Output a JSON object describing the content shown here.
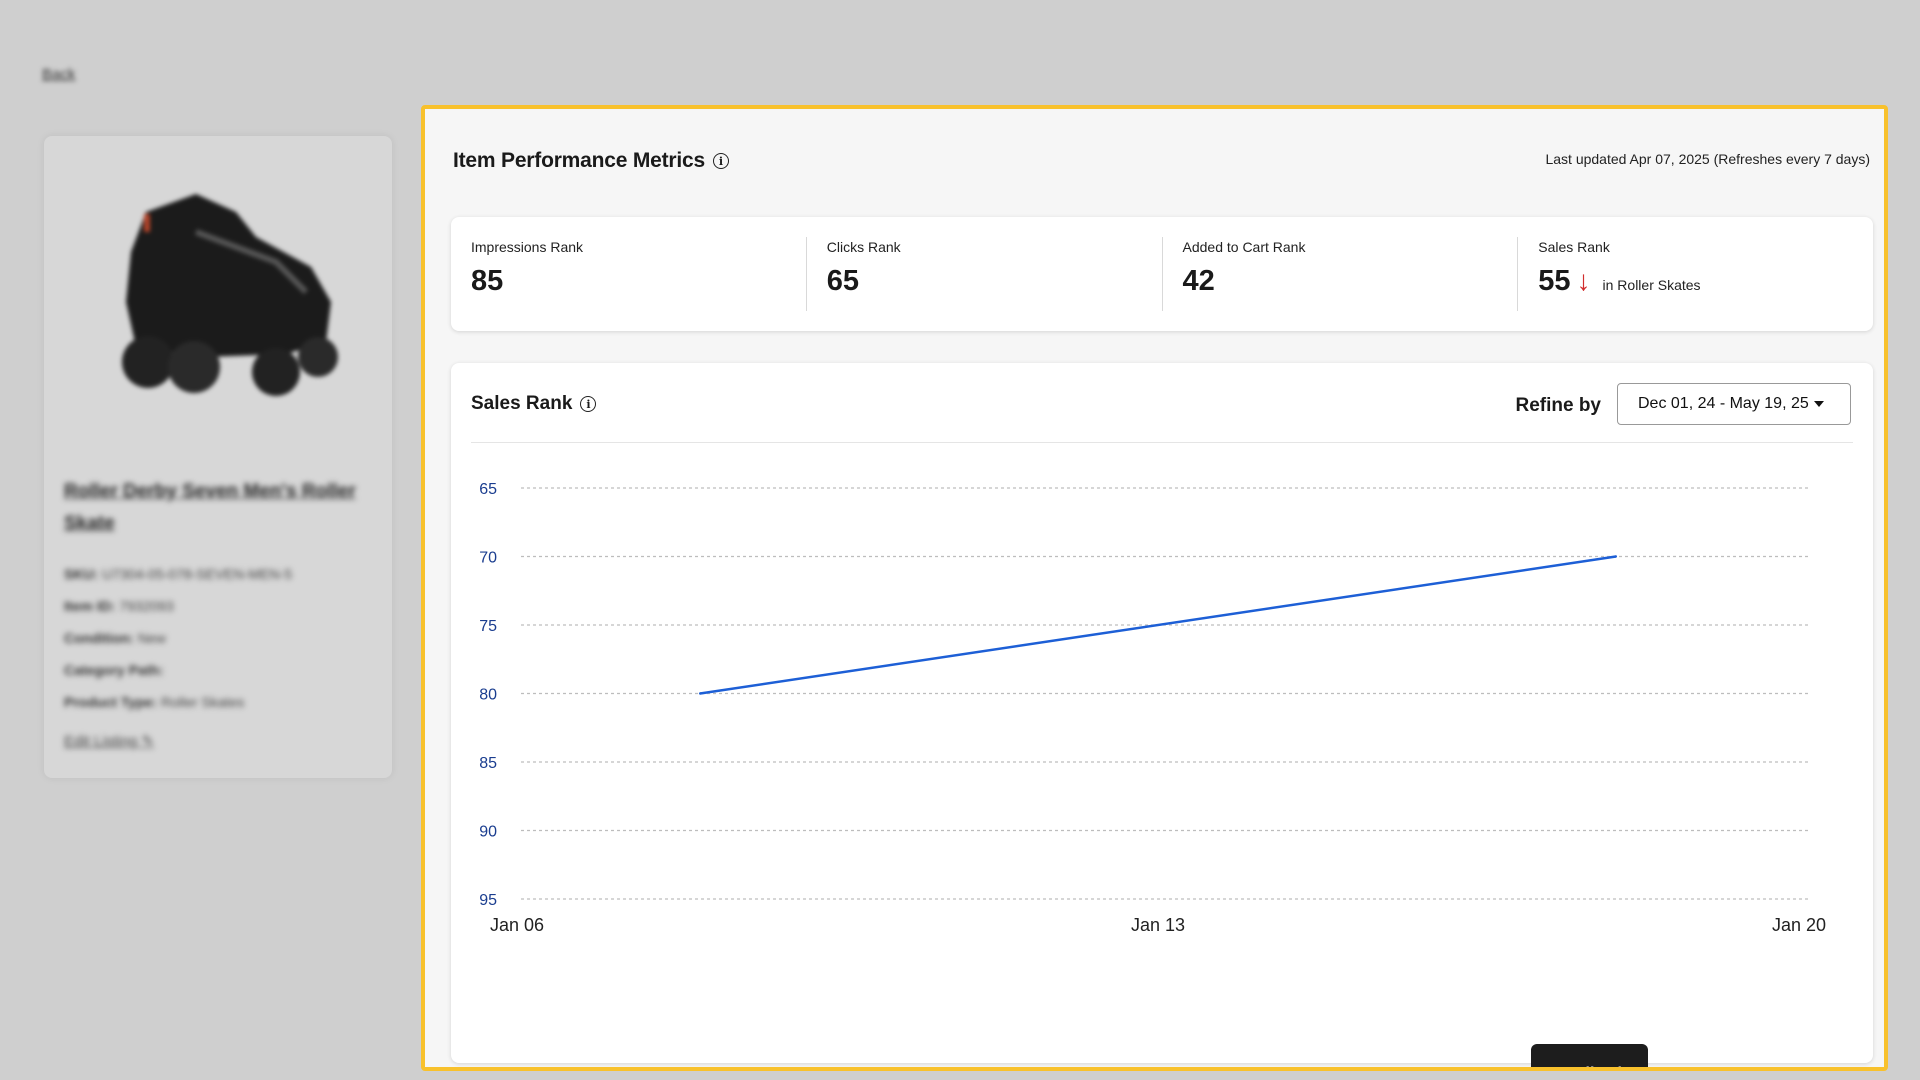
{
  "background": {
    "back_label": "Back",
    "product": {
      "title": "Roller Derby Seven Men's Roller Skate",
      "details": [
        {
          "label": "SKU:",
          "value": "U7304-05-078-SEVEN-MEN-5"
        },
        {
          "label": "Item ID:",
          "value": "7932093"
        },
        {
          "label": "Condition:",
          "value": "New"
        },
        {
          "label": "Category Path:",
          "value": ""
        },
        {
          "label": "Product Type:",
          "value": "Roller Skates"
        }
      ],
      "edit_label": "Edit Listing"
    }
  },
  "panel": {
    "title": "Item Performance Metrics",
    "last_updated": "Last updated Apr 07, 2025 (Refreshes every 7 days)"
  },
  "ranks": [
    {
      "label": "Impressions Rank",
      "value": "85"
    },
    {
      "label": "Clicks Rank",
      "value": "65"
    },
    {
      "label": "Added to Cart Rank",
      "value": "42"
    },
    {
      "label": "Sales Rank",
      "value": "55",
      "trend": "↓",
      "context": "in Roller Skates"
    }
  ],
  "chart_section": {
    "title": "Sales Rank",
    "refine_label": "Refine by",
    "date_range": "Dec 01, 24 - May 19, 25"
  },
  "feedback_label": "Feedback",
  "colors": {
    "highlight": "#f8c12c",
    "line": "#1d5fd6",
    "tick_y": "#1a3d8f",
    "trend_down": "#d12d2d"
  },
  "chart_data": {
    "type": "line",
    "title": "Sales Rank",
    "xlabel": "",
    "ylabel": "",
    "x_ticks": [
      "Jan 06",
      "Jan 13",
      "Jan 20"
    ],
    "y_ticks": [
      65,
      70,
      75,
      80,
      85,
      90,
      95
    ],
    "ylim": [
      65,
      95
    ],
    "y_inverted": true,
    "grid": true,
    "series": [
      {
        "x": [
          "Jan 08",
          "Jan 18"
        ],
        "values": [
          80,
          70
        ]
      }
    ]
  }
}
